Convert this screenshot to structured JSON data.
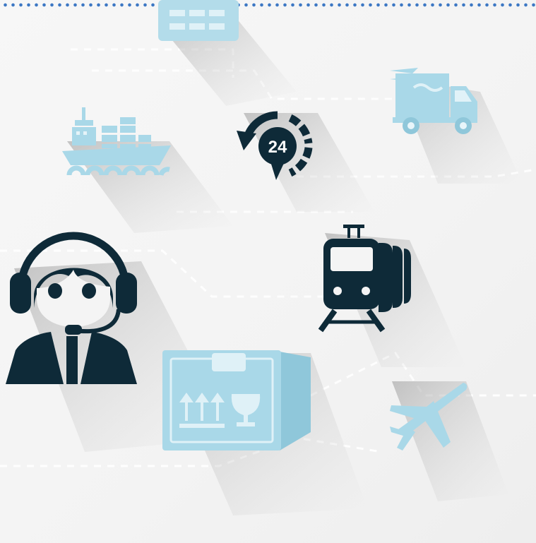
{
  "badge_24": {
    "text": "24"
  },
  "colors": {
    "dark": "#0e2a38",
    "light_blue": "#a9d8e8",
    "light_blue_dark": "#8fc7da",
    "dots": "#3d78c4",
    "background": "#f5f5f5"
  },
  "icons": [
    "crate-icon",
    "cargo-ship-icon",
    "clock-24-icon",
    "delivery-truck-icon",
    "customer-support-agent-icon",
    "train-icon",
    "package-box-icon",
    "airplane-icon"
  ]
}
